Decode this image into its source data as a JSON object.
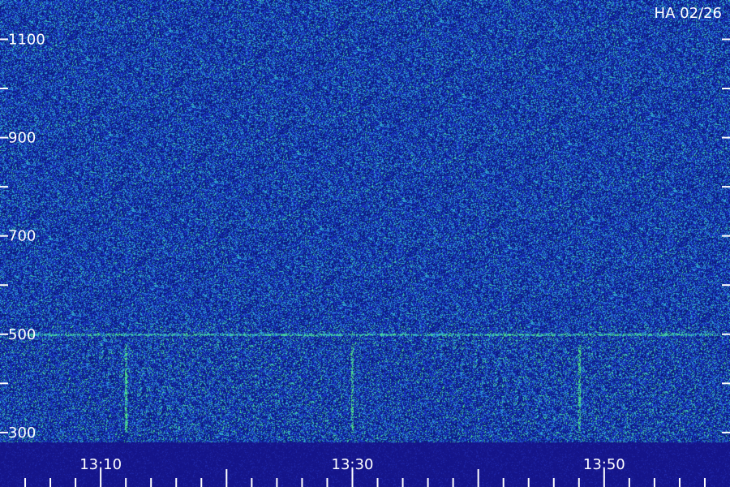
{
  "station_label": "HA 02/26",
  "chart_data": {
    "type": "heatmap",
    "title": "",
    "xlabel": "",
    "ylabel": "",
    "x_tick_labels": [
      "13:10",
      "13:30",
      "13:50"
    ],
    "x_range": [
      "13:02",
      "14:00"
    ],
    "x_minor_tick_minutes": 2,
    "y_tick_labels": [
      "300",
      "500",
      "700",
      "900",
      "1100"
    ],
    "y_range": [
      280,
      1180
    ],
    "y_minor_tick_step": 100,
    "grid": false,
    "legend": "none",
    "colormap": {
      "background": "#0a1a7a",
      "noise_low": "#1c36c8",
      "noise_mid": "#2fa4d6",
      "signal_high": "#4ee08a",
      "axis_band": "#14148a",
      "text": "#ffffff"
    },
    "features": [
      {
        "kind": "horizontal_band",
        "y": 500,
        "x_start": "13:04",
        "x_end": "13:59",
        "intensity": 0.5
      },
      {
        "kind": "vertical_burst",
        "x": "13:12",
        "y_from": 300,
        "y_to": 480,
        "intensity": 0.95
      },
      {
        "kind": "vertical_burst",
        "x": "13:30",
        "y_from": 300,
        "y_to": 480,
        "intensity": 0.95
      },
      {
        "kind": "vertical_burst",
        "x": "13:48",
        "y_from": 300,
        "y_to": 480,
        "intensity": 0.95
      },
      {
        "kind": "vertical_faint",
        "x": "13:04",
        "y_from": 300,
        "y_to": 330,
        "intensity": 0.6
      },
      {
        "kind": "vertical_faint",
        "x": "13:16",
        "y_from": 300,
        "y_to": 330,
        "intensity": 0.5
      }
    ]
  }
}
